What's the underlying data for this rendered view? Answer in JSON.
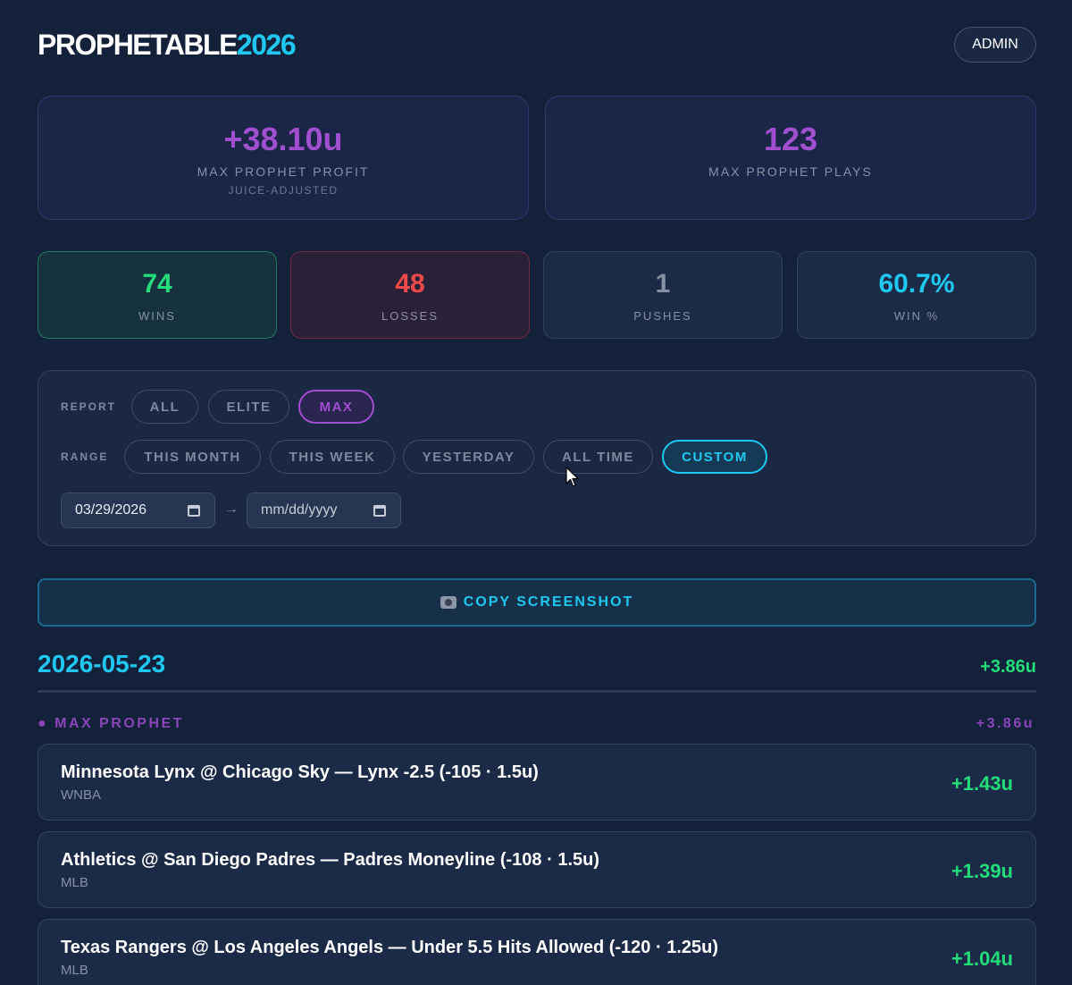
{
  "header": {
    "logo_primary": "PROPHETABLE",
    "logo_accent": "2026",
    "admin_label": "ADMIN"
  },
  "summary": {
    "profit": {
      "value": "+38.10u",
      "label": "MAX PROPHET PROFIT",
      "sublabel": "JUICE-ADJUSTED"
    },
    "plays": {
      "value": "123",
      "label": "MAX PROPHET PLAYS"
    }
  },
  "stats": [
    {
      "value": "74",
      "label": "WINS",
      "color": "#22dd7a"
    },
    {
      "value": "48",
      "label": "LOSSES",
      "color": "#f04a48"
    },
    {
      "value": "1",
      "label": "PUSHES",
      "color": "#8791a6"
    },
    {
      "value": "60.7%",
      "label": "WIN %",
      "color": "#1ec8f0"
    }
  ],
  "filters": {
    "report_label": "REPORT",
    "report_options": [
      "ALL",
      "ELITE",
      "MAX"
    ],
    "report_selected": "MAX",
    "range_label": "RANGE",
    "range_options": [
      "THIS MONTH",
      "THIS WEEK",
      "YESTERDAY",
      "ALL TIME",
      "CUSTOM"
    ],
    "range_selected": "CUSTOM",
    "start_date": "03/29/2026",
    "end_date_placeholder": "mm/dd/yyyy",
    "arrow": "→"
  },
  "copy_button": {
    "label": "COPY SCREENSHOT",
    "icon": "camera-icon"
  },
  "day": {
    "date": "2026-05-23",
    "total": "+3.86u",
    "group": {
      "label": "● MAX PROPHET",
      "total": "+3.86u"
    },
    "plays": [
      {
        "title": "Minnesota Lynx @ Chicago Sky — Lynx -2.5 (-105 · 1.5u)",
        "league": "WNBA",
        "result": "+1.43u"
      },
      {
        "title": "Athletics @ San Diego Padres — Padres Moneyline (-108 · 1.5u)",
        "league": "MLB",
        "result": "+1.39u"
      },
      {
        "title": "Texas Rangers @ Los Angeles Angels — Under 5.5 Hits Allowed (-120 · 1.25u)",
        "league": "MLB",
        "result": "+1.04u"
      }
    ]
  },
  "colors": {
    "accent_cyan": "#1ec8f0",
    "accent_purple": "#a04fcf",
    "win_green": "#22dd7a",
    "loss_red": "#f04a48",
    "background": "#13213b"
  }
}
